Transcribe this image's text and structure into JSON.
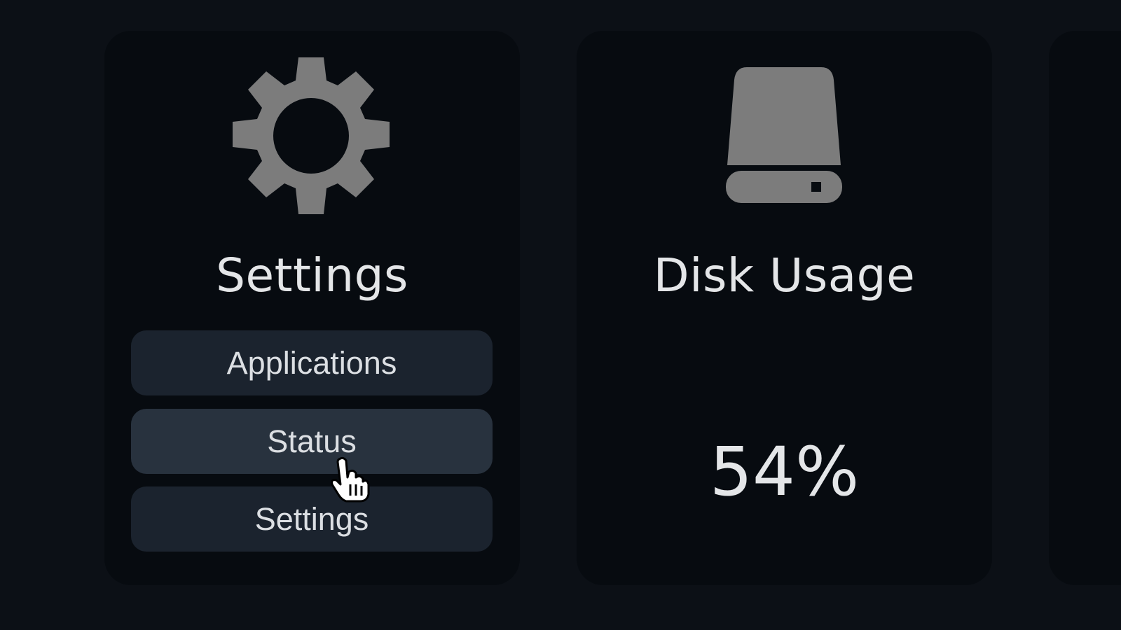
{
  "cards": {
    "settings": {
      "icon": "gear-icon",
      "title": "Settings",
      "buttons": [
        {
          "label": "Applications",
          "state": "default"
        },
        {
          "label": "Status",
          "state": "hover"
        },
        {
          "label": "Settings",
          "state": "default"
        }
      ]
    },
    "disk": {
      "icon": "hard-drive-icon",
      "title": "Disk Usage",
      "value": "54%"
    }
  },
  "cursor": {
    "icon": "hand-pointer-icon"
  },
  "colors": {
    "background": "#0c1016",
    "card": "#070b10",
    "button": "#1b232e",
    "button_hover": "#28323e",
    "icon": "#7c7c7c",
    "text": "#e4e6e8"
  }
}
